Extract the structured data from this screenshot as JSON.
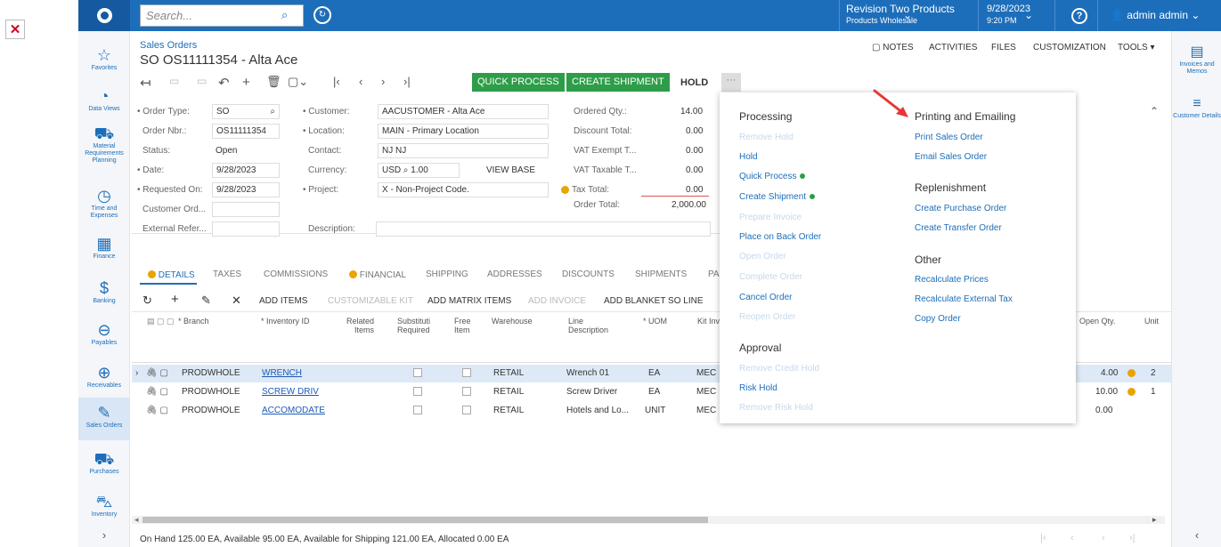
{
  "broken_image": "broken-image-icon",
  "top": {
    "search_placeholder": "Search...",
    "company": "Revision Two Products",
    "branch": "Products Wholesale",
    "date": "9/28/2023",
    "time": "9:20 PM",
    "user": "admin admin"
  },
  "leftnav": [
    {
      "label": "Favorites",
      "icon": "star-icon"
    },
    {
      "label": "Data Views",
      "icon": "chart-icon"
    },
    {
      "label": "Material Requirements Planning",
      "icon": "cart-icon"
    },
    {
      "label": "Time and Expenses",
      "icon": "clock-icon"
    },
    {
      "label": "Finance",
      "icon": "calculator-icon"
    },
    {
      "label": "Banking",
      "icon": "dollar-icon"
    },
    {
      "label": "Payables",
      "icon": "minus-icon"
    },
    {
      "label": "Receivables",
      "icon": "plus-icon"
    },
    {
      "label": "Sales Orders",
      "icon": "pencil-icon"
    },
    {
      "label": "Purchases",
      "icon": "cart-icon"
    },
    {
      "label": "Inventory",
      "icon": "truck-icon"
    }
  ],
  "rightnav": [
    {
      "label": "Invoices and Memos"
    },
    {
      "label": "Customer Details"
    }
  ],
  "page": {
    "breadcrumb": "Sales Orders",
    "title": "SO OS11111354 - Alta Ace"
  },
  "header_links": {
    "notes": "NOTES",
    "activities": "ACTIVITIES",
    "files": "FILES",
    "customization": "CUSTOMIZATION",
    "tools": "TOOLS ▾"
  },
  "toolbar": {
    "quick_process": "QUICK PROCESS",
    "create_shipment": "CREATE SHIPMENT",
    "hold": "HOLD",
    "more": "···"
  },
  "form": {
    "order_type_label": "• Order Type:",
    "order_type": "SO",
    "order_nbr_label": "Order Nbr.:",
    "order_nbr": "OS11111354",
    "status_label": "Status:",
    "status": "Open",
    "date_label": "• Date:",
    "date": "9/28/2023",
    "requested_label": "• Requested On:",
    "requested": "9/28/2023",
    "customer_ord_label": "Customer Ord...",
    "external_label": "External Refer...",
    "customer_label": "• Customer:",
    "customer": "AACUSTOMER - Alta Ace",
    "location_label": "• Location:",
    "location": "MAIN - Primary Location",
    "contact_label": "Contact:",
    "contact": "NJ NJ",
    "currency_label": "Currency:",
    "currency": "USD",
    "rate": "1.00",
    "view_base": "VIEW BASE",
    "project_label": "• Project:",
    "project": "X - Non-Project Code.",
    "description_label": "Description:",
    "ordered_qty_label": "Ordered Qty.:",
    "ordered_qty": "14.00",
    "discount_label": "Discount Total:",
    "discount": "0.00",
    "vat_exempt_label": "VAT Exempt T...",
    "vat_exempt": "0.00",
    "vat_taxable_label": "VAT Taxable T...",
    "vat_taxable": "0.00",
    "tax_total_label": "Tax Total:",
    "tax_total": "0.00",
    "order_total_label": "Order Total:",
    "order_total": "2,000.00"
  },
  "tabs": [
    "DETAILS",
    "TAXES",
    "COMMISSIONS",
    "FINANCIAL",
    "SHIPPING",
    "ADDRESSES",
    "DISCOUNTS",
    "SHIPMENTS",
    "PA"
  ],
  "grid_toolbar": {
    "add_items": "ADD ITEMS",
    "customizable_kit": "CUSTOMIZABLE KIT",
    "add_matrix": "ADD MATRIX ITEMS",
    "add_invoice": "ADD INVOICE",
    "add_blanket": "ADD BLANKET SO LINE"
  },
  "grid_headers": {
    "branch": "* Branch",
    "inventory_id": "* Inventory ID",
    "related": "Related Items",
    "substitute": "Substituti Required",
    "free": "Free Item",
    "warehouse": "Warehouse",
    "line_desc": "Line Description",
    "uom": "* UOM",
    "kit": "Kit Inv",
    "open_qty": "Open Qty.",
    "unit": "Unit"
  },
  "rows": [
    {
      "branch": "PRODWHOLE",
      "item": "WRENCH",
      "warehouse": "RETAIL",
      "desc": "Wrench 01",
      "uom": "EA",
      "kit": "MEC",
      "open_qty": "4.00",
      "unit": "2"
    },
    {
      "branch": "PRODWHOLE",
      "item": "SCREW DRIV",
      "warehouse": "RETAIL",
      "desc": "Screw Driver",
      "uom": "EA",
      "kit": "MEC",
      "open_qty": "10.00",
      "unit": "1"
    },
    {
      "branch": "PRODWHOLE",
      "item": "ACCOMODATE",
      "warehouse": "RETAIL",
      "desc": "Hotels and Lo...",
      "uom": "UNIT",
      "kit": "MEC",
      "open_qty": "0.00",
      "unit": ""
    }
  ],
  "status_bar": "On Hand 125.00 EA, Available 95.00 EA, Available for Shipping 121.00 EA, Allocated 0.00 EA",
  "menu": {
    "processing": {
      "title": "Processing",
      "items": [
        "Remove Hold",
        "Hold",
        "Quick Process",
        "Create Shipment",
        "Prepare Invoice",
        "Place on Back Order",
        "Open Order",
        "Complete Order",
        "Cancel Order",
        "Reopen Order"
      ]
    },
    "approval": {
      "title": "Approval",
      "items": [
        "Remove Credit Hold",
        "Risk Hold",
        "Remove Risk Hold"
      ]
    },
    "printing": {
      "title": "Printing and Emailing",
      "items": [
        "Print Sales Order",
        "Email Sales Order"
      ]
    },
    "replenishment": {
      "title": "Replenishment",
      "items": [
        "Create Purchase Order",
        "Create Transfer Order"
      ]
    },
    "other": {
      "title": "Other",
      "items": [
        "Recalculate Prices",
        "Recalculate External Tax",
        "Copy Order"
      ]
    }
  },
  "colors": {
    "brand": "#1d6eba",
    "action_green": "#2e9d49",
    "annotation_arrow": "#e53935"
  }
}
